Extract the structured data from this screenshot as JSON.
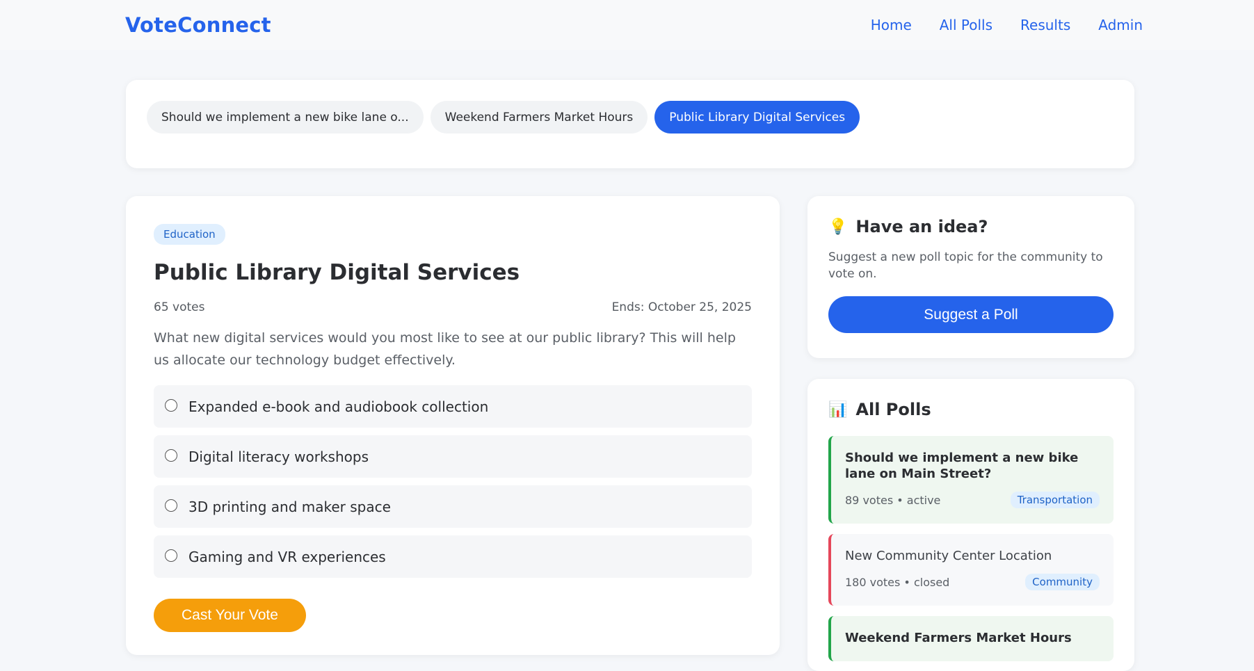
{
  "header": {
    "brand": "VoteConnect",
    "nav": [
      "Home",
      "All Polls",
      "Results",
      "Admin"
    ]
  },
  "tabs": [
    {
      "label": "Should we implement a new bike lane o...",
      "active": false
    },
    {
      "label": "Weekend Farmers Market Hours",
      "active": false
    },
    {
      "label": "Public Library Digital Services",
      "active": true
    }
  ],
  "poll": {
    "category": "Education",
    "title": "Public Library Digital Services",
    "votes": "65 votes",
    "ends": "Ends: October 25, 2025",
    "description": "What new digital services would you most like to see at our public library? This will help us allocate our technology budget effectively.",
    "options": [
      "Expanded e-book and audiobook collection",
      "Digital literacy workshops",
      "3D printing and maker space",
      "Gaming and VR experiences"
    ],
    "vote_button": "Cast Your Vote"
  },
  "idea": {
    "icon": "lightbulb-icon",
    "emoji": "💡",
    "title": "Have an idea?",
    "text": "Suggest a new poll topic for the community to vote on.",
    "button": "Suggest a Poll"
  },
  "all_polls": {
    "icon": "bar-chart-icon",
    "emoji": "📊",
    "title": "All Polls",
    "items": [
      {
        "title": "Should we implement a new bike lane on Main Street?",
        "meta": "89 votes • active",
        "tag": "Transportation",
        "status": "active"
      },
      {
        "title": "New Community Center Location",
        "meta": "180 votes • closed",
        "tag": "Community",
        "status": "closed"
      },
      {
        "title": "Weekend Farmers Market Hours",
        "meta": "",
        "tag": "",
        "status": "active"
      }
    ]
  },
  "colors": {
    "primary": "#2563eb",
    "accent": "#f59e0b",
    "active": "#22a54a",
    "closed": "#e5475a"
  }
}
